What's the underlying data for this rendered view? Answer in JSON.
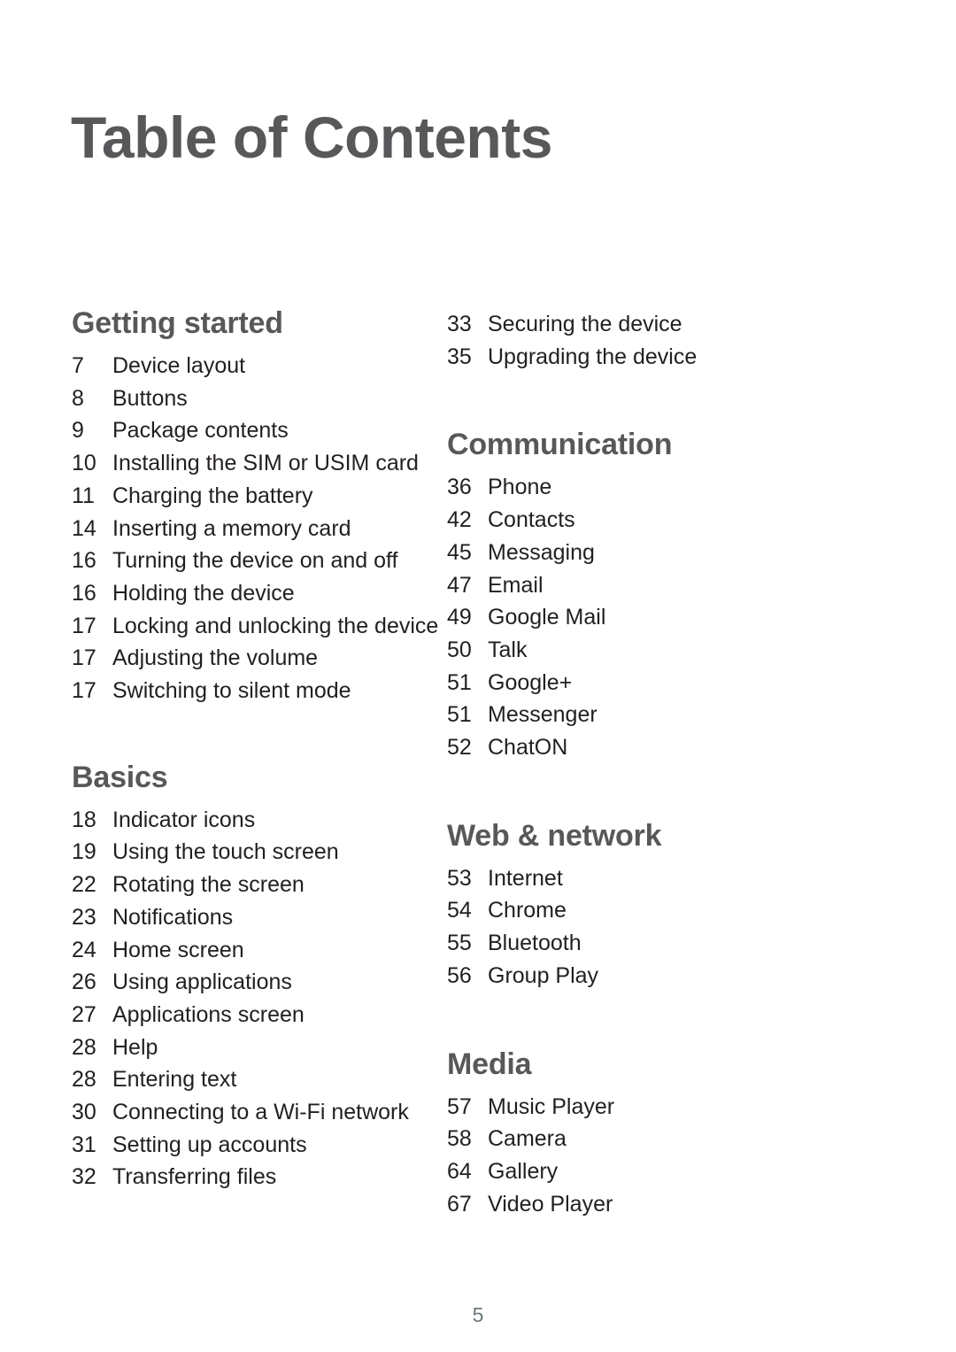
{
  "document": {
    "title": "Table of Contents",
    "folio": "5"
  },
  "columns": {
    "left": [
      {
        "heading": "Getting started",
        "entries": [
          {
            "page": "7",
            "label": "Device layout"
          },
          {
            "page": "8",
            "label": "Buttons"
          },
          {
            "page": "9",
            "label": "Package contents"
          },
          {
            "page": "10",
            "label": "Installing the SIM or USIM card"
          },
          {
            "page": "11",
            "label": "Charging the battery"
          },
          {
            "page": "14",
            "label": "Inserting a memory card"
          },
          {
            "page": "16",
            "label": "Turning the device on and off"
          },
          {
            "page": "16",
            "label": "Holding the device"
          },
          {
            "page": "17",
            "label": "Locking and unlocking the device"
          },
          {
            "page": "17",
            "label": "Adjusting the volume"
          },
          {
            "page": "17",
            "label": "Switching to silent mode"
          }
        ]
      },
      {
        "heading": "Basics",
        "entries": [
          {
            "page": "18",
            "label": "Indicator icons"
          },
          {
            "page": "19",
            "label": "Using the touch screen"
          },
          {
            "page": "22",
            "label": "Rotating the screen"
          },
          {
            "page": "23",
            "label": "Notifications"
          },
          {
            "page": "24",
            "label": "Home screen"
          },
          {
            "page": "26",
            "label": "Using applications"
          },
          {
            "page": "27",
            "label": "Applications screen"
          },
          {
            "page": "28",
            "label": "Help"
          },
          {
            "page": "28",
            "label": "Entering text"
          },
          {
            "page": "30",
            "label": "Connecting to a Wi-Fi network"
          },
          {
            "page": "31",
            "label": "Setting up accounts"
          },
          {
            "page": "32",
            "label": "Transferring files"
          }
        ]
      }
    ],
    "right": [
      {
        "heading": "",
        "entries": [
          {
            "page": "33",
            "label": "Securing the device"
          },
          {
            "page": "35",
            "label": "Upgrading the device"
          }
        ]
      },
      {
        "heading": "Communication",
        "entries": [
          {
            "page": "36",
            "label": "Phone"
          },
          {
            "page": "42",
            "label": "Contacts"
          },
          {
            "page": "45",
            "label": "Messaging"
          },
          {
            "page": "47",
            "label": "Email"
          },
          {
            "page": "49",
            "label": "Google Mail"
          },
          {
            "page": "50",
            "label": "Talk"
          },
          {
            "page": "51",
            "label": "Google+"
          },
          {
            "page": "51",
            "label": "Messenger"
          },
          {
            "page": "52",
            "label": "ChatON"
          }
        ]
      },
      {
        "heading": "Web & network",
        "entries": [
          {
            "page": "53",
            "label": "Internet"
          },
          {
            "page": "54",
            "label": "Chrome"
          },
          {
            "page": "55",
            "label": "Bluetooth"
          },
          {
            "page": "56",
            "label": "Group Play"
          }
        ]
      },
      {
        "heading": "Media",
        "entries": [
          {
            "page": "57",
            "label": "Music Player"
          },
          {
            "page": "58",
            "label": "Camera"
          },
          {
            "page": "64",
            "label": "Gallery"
          },
          {
            "page": "67",
            "label": "Video Player"
          }
        ]
      }
    ]
  },
  "colors": {
    "heading": "#58585b",
    "entry": "#231f20",
    "folio": "#6b757a",
    "background": "#ffffff"
  }
}
